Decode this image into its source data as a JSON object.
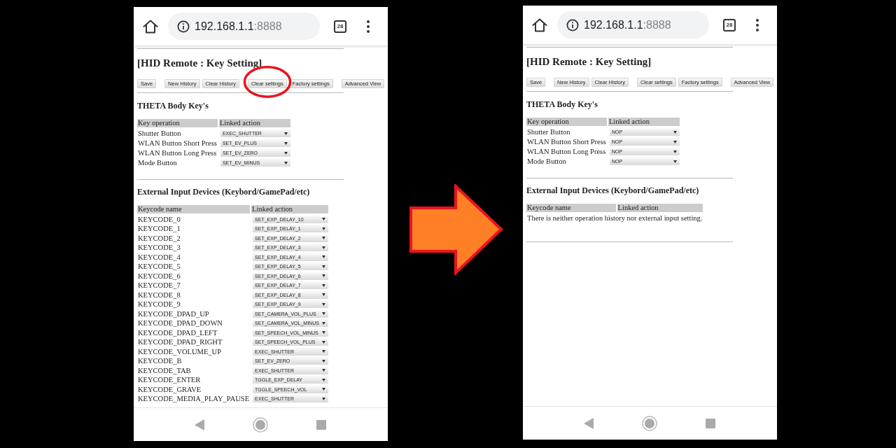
{
  "screens": [
    {
      "browser": {
        "url_host": "192.168.1.1",
        "url_port": ":8888",
        "tab_count": "28"
      },
      "title": "[HID Remote : Key Setting]",
      "button_groups": [
        [
          {
            "label": "Save",
            "circled": false
          }
        ],
        [
          {
            "label": "New History",
            "circled": false
          },
          {
            "label": "Clear History",
            "circled": false
          }
        ],
        [
          {
            "label": "Clear settings",
            "circled": true
          },
          {
            "label": "Factory settings",
            "circled": false
          }
        ],
        [
          {
            "label": "Advanced View",
            "circled": false
          }
        ]
      ],
      "body_keys": {
        "heading": "THETA Body Key's",
        "columns": [
          "Key operation",
          "Linked action"
        ],
        "rows": [
          {
            "key": "Shutter Button",
            "action": "EXEC_SHUTTER"
          },
          {
            "key": "WLAN Button Short Press",
            "action": "SET_EV_PLUS"
          },
          {
            "key": "WLAN Button Long Press",
            "action": "SET_EV_ZERO"
          },
          {
            "key": "Mode Button",
            "action": "SET_EV_MINUS"
          }
        ]
      },
      "external_inputs": {
        "heading": "External Input Devices (Keybord/GamePad/etc)",
        "columns": [
          "Keycode name",
          "Linked action"
        ],
        "rows": [
          {
            "key": "KEYCODE_0",
            "action": "SET_EXP_DELAY_10"
          },
          {
            "key": "KEYCODE_1",
            "action": "SET_EXP_DELAY_1"
          },
          {
            "key": "KEYCODE_2",
            "action": "SET_EXP_DELAY_2"
          },
          {
            "key": "KEYCODE_3",
            "action": "SET_EXP_DELAY_3"
          },
          {
            "key": "KEYCODE_4",
            "action": "SET_EXP_DELAY_4"
          },
          {
            "key": "KEYCODE_5",
            "action": "SET_EXP_DELAY_5"
          },
          {
            "key": "KEYCODE_6",
            "action": "SET_EXP_DELAY_6"
          },
          {
            "key": "KEYCODE_7",
            "action": "SET_EXP_DELAY_7"
          },
          {
            "key": "KEYCODE_8",
            "action": "SET_EXP_DELAY_8"
          },
          {
            "key": "KEYCODE_9",
            "action": "SET_EXP_DELAY_9"
          },
          {
            "key": "KEYCODE_DPAD_UP",
            "action": "SET_CAMERA_VOL_PLUS"
          },
          {
            "key": "KEYCODE_DPAD_DOWN",
            "action": "SET_CAMERA_VOL_MINUS"
          },
          {
            "key": "KEYCODE_DPAD_LEFT",
            "action": "SET_SPEECH_VOL_MINUS"
          },
          {
            "key": "KEYCODE_DPAD_RIGHT",
            "action": "SET_SPEECH_VOL_PLUS"
          },
          {
            "key": "KEYCODE_VOLUME_UP",
            "action": "EXEC_SHUTTER"
          },
          {
            "key": "KEYCODE_B",
            "action": "SET_EV_ZERO"
          },
          {
            "key": "KEYCODE_TAB",
            "action": "EXEC_SHUTTER"
          },
          {
            "key": "KEYCODE_ENTER",
            "action": "TGGLE_EXP_DELAY"
          },
          {
            "key": "KEYCODE_GRAVE",
            "action": "TGGLE_SPEECH_VOL"
          },
          {
            "key": "KEYCODE_MEDIA_PLAY_PAUSE",
            "action": "EXEC_SHUTTER"
          }
        ]
      }
    },
    {
      "browser": {
        "url_host": "192.168.1.1",
        "url_port": ":8888",
        "tab_count": "28"
      },
      "title": "[HID Remote : Key Setting]",
      "button_groups": [
        [
          {
            "label": "Save",
            "circled": false
          }
        ],
        [
          {
            "label": "New History",
            "circled": false
          },
          {
            "label": "Clear History",
            "circled": false
          }
        ],
        [
          {
            "label": "Clear settings",
            "circled": false
          },
          {
            "label": "Factory settings",
            "circled": false
          }
        ],
        [
          {
            "label": "Advanced View",
            "circled": false
          }
        ]
      ],
      "body_keys": {
        "heading": "THETA Body Key's",
        "columns": [
          "Key operation",
          "Linked action"
        ],
        "rows": [
          {
            "key": "Shutter Button",
            "action": "NOP"
          },
          {
            "key": "WLAN Button Short Press",
            "action": "NOP"
          },
          {
            "key": "WLAN Button Long Press",
            "action": "NOP"
          },
          {
            "key": "Mode Button",
            "action": "NOP"
          }
        ]
      },
      "external_inputs": {
        "heading": "External Input Devices (Keybord/GamePad/etc)",
        "columns": [
          "Keycode name",
          "Linked action"
        ],
        "message": "There is neither operation history nor external input setting."
      }
    }
  ]
}
